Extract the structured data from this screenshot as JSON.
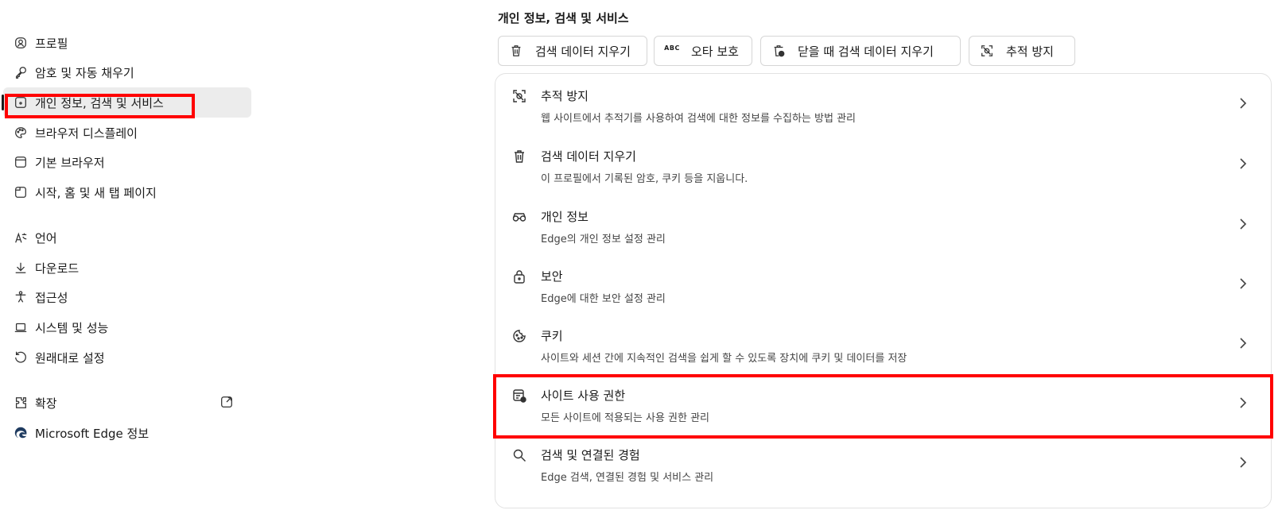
{
  "sidebar": {
    "items": [
      {
        "label": "프로필",
        "icon": "profile-icon"
      },
      {
        "label": "암호 및 자동 채우기",
        "icon": "key-icon"
      },
      {
        "label": "개인 정보, 검색 및 서비스",
        "icon": "privacy-lock-icon",
        "selected": true
      },
      {
        "label": "브라우저 디스플레이",
        "icon": "palette-icon"
      },
      {
        "label": "기본 브라우저",
        "icon": "browser-icon"
      },
      {
        "label": "시작, 홈 및 새 탭 페이지",
        "icon": "home-tab-icon"
      },
      {
        "label": "언어",
        "icon": "language-icon"
      },
      {
        "label": "다운로드",
        "icon": "download-icon"
      },
      {
        "label": "접근성",
        "icon": "accessibility-icon"
      },
      {
        "label": "시스템 및 성능",
        "icon": "laptop-icon"
      },
      {
        "label": "원래대로 설정",
        "icon": "reset-icon"
      },
      {
        "label": "확장",
        "icon": "extensions-icon"
      },
      {
        "label": "Microsoft Edge 정보",
        "icon": "edge-logo-icon"
      }
    ]
  },
  "main": {
    "title": "개인 정보, 검색 및 서비스",
    "chips": [
      {
        "label": "검색 데이터 지우기",
        "icon": "trash-icon"
      },
      {
        "label": "오타 보호",
        "icon": "spellcheck-icon",
        "icon_text": "ABC"
      },
      {
        "label": "닫을 때 검색 데이터 지우기",
        "icon": "trash-clock-icon"
      },
      {
        "label": "추적 방지",
        "icon": "tracking-prevention-icon"
      }
    ],
    "rows": [
      {
        "title": "추적 방지",
        "desc": "웹 사이트에서 추적기를 사용하여 검색에 대한 정보를 수집하는 방법 관리",
        "icon": "tracking-prevention-icon"
      },
      {
        "title": "검색 데이터 지우기",
        "desc": "이 프로필에서 기록된 암호, 쿠키 등을 지웁니다.",
        "icon": "trash-icon"
      },
      {
        "title": "개인 정보",
        "desc": "Edge의 개인 정보 설정 관리",
        "icon": "glasses-icon"
      },
      {
        "title": "보안",
        "desc": "Edge에 대한 보안 설정 관리",
        "icon": "lock-icon"
      },
      {
        "title": "쿠키",
        "desc": "사이트와 세션 간에 지속적인 검색을 쉽게 할 수 있도록 장치에 쿠키 및 데이터를 저장",
        "icon": "cookie-icon"
      },
      {
        "title": "사이트 사용 권한",
        "desc": "모든 사이트에 적용되는 사용 권한 관리",
        "icon": "site-permissions-icon"
      },
      {
        "title": "검색 및 연결된 경험",
        "desc": "Edge 검색, 연결된 경험 및 서비스 관리",
        "icon": "search-icon"
      }
    ]
  },
  "colors": {
    "highlight": "#ff0000",
    "selected_bg": "#ececec"
  }
}
